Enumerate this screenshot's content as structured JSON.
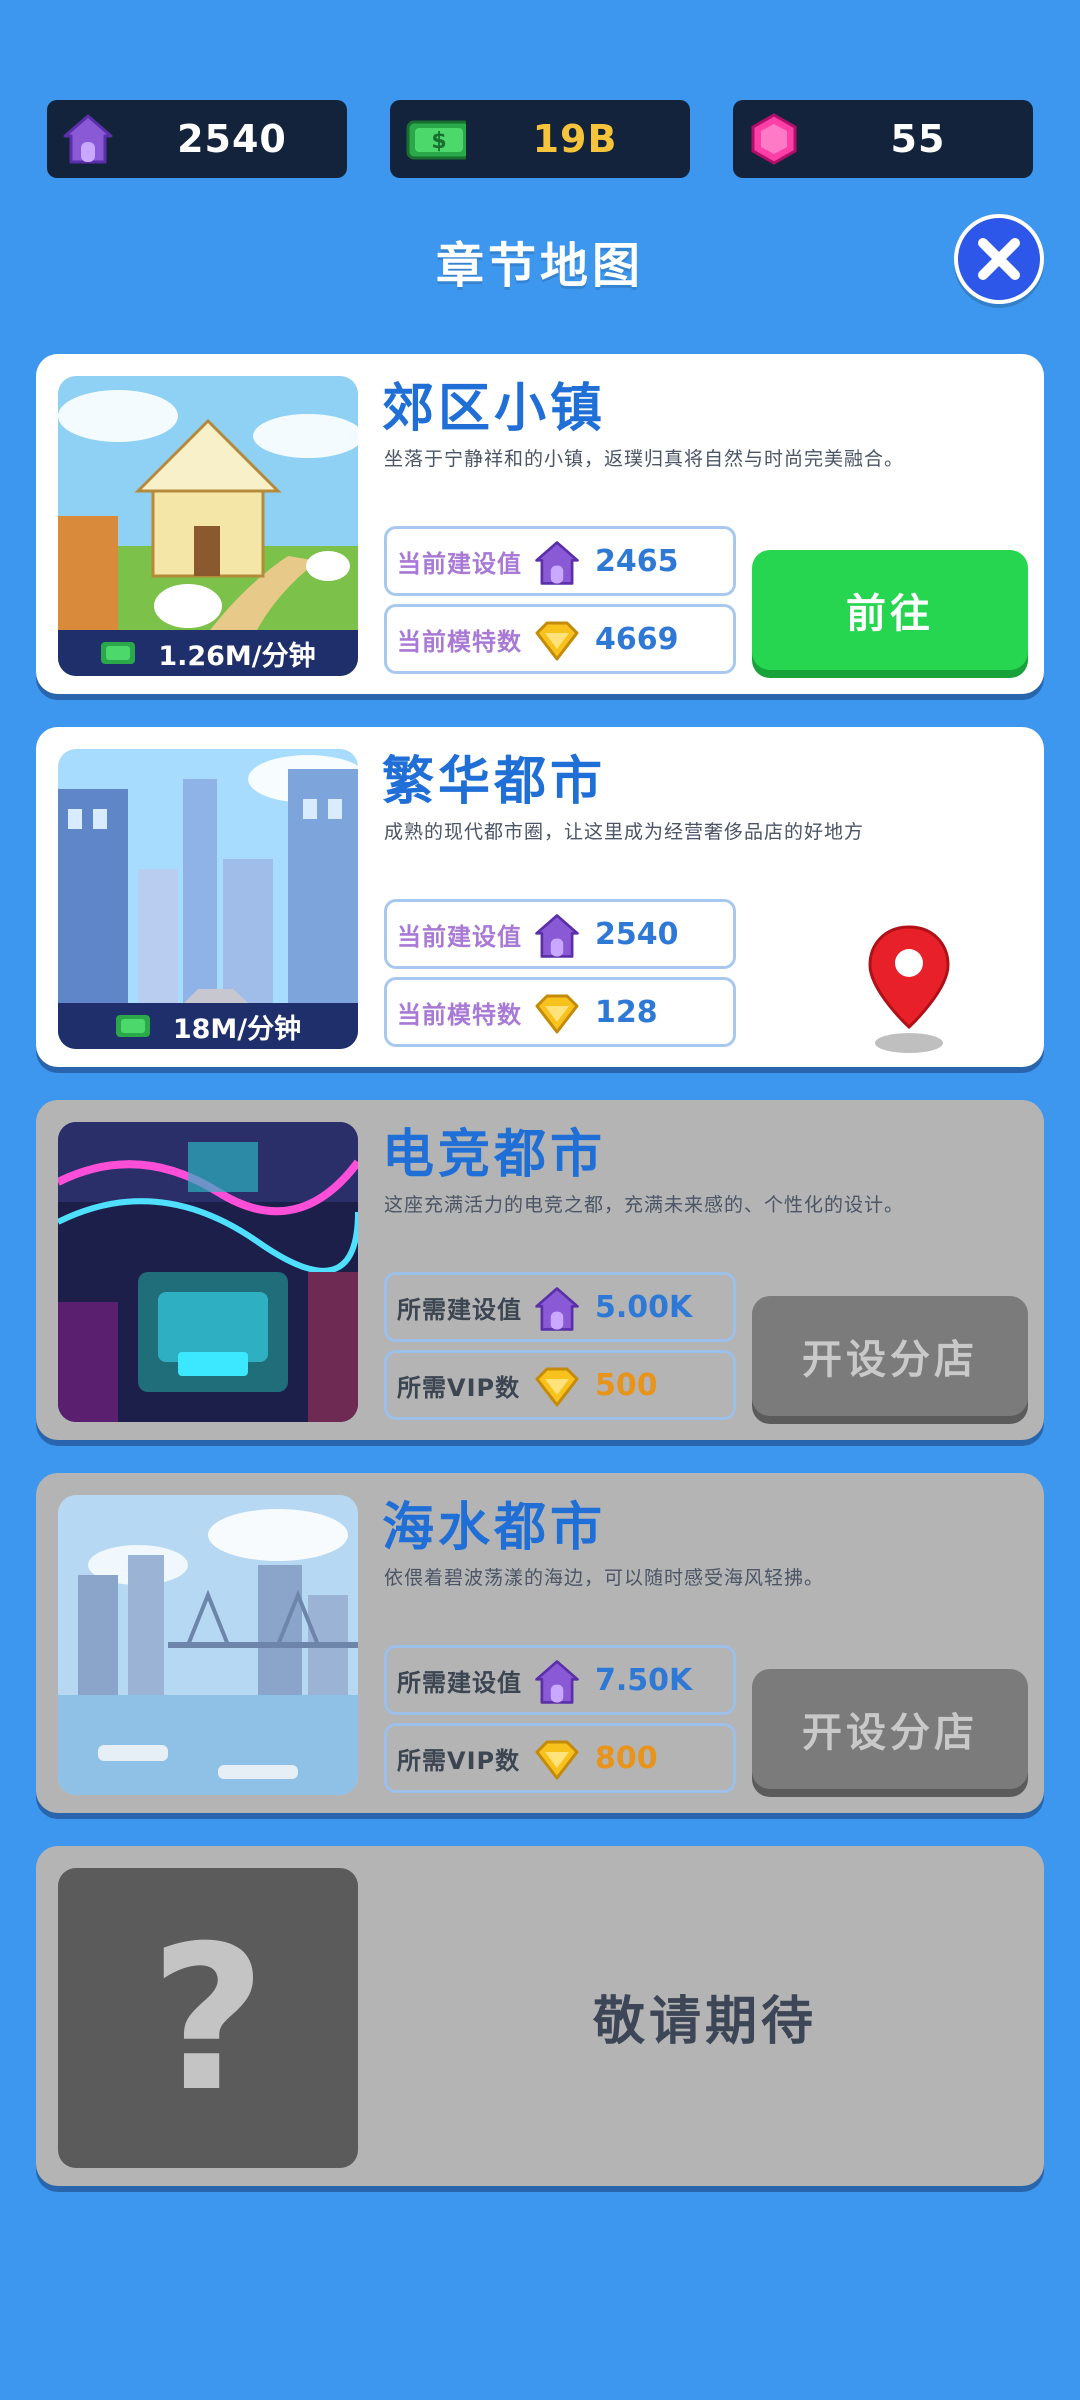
{
  "resources": {
    "build_value": "2540",
    "cash": "19B",
    "gems": "55"
  },
  "title": "章节地图",
  "colors": {
    "background": "#3d97ee",
    "card_white": "#ffffff",
    "card_locked": "#b4b4b4",
    "go_button": "#27d650",
    "locked_button": "#7b7b7b",
    "title_blue": "#1f6fd6"
  },
  "chapters": [
    {
      "name": "郊区小镇",
      "description": "坐落于宁静祥和的小镇，返璞归真将自然与时尚完美融合。",
      "rate": "1.26M/分钟",
      "stat1_label": "当前建设值",
      "stat1_value": "2465",
      "stat2_label": "当前模特数",
      "stat2_value": "4669",
      "action": "前往",
      "state": "unlocked"
    },
    {
      "name": "繁华都市",
      "description": "成熟的现代都市圈，让这里成为经营奢侈品店的好地方",
      "rate": "18M/分钟",
      "stat1_label": "当前建设值",
      "stat1_value": "2540",
      "stat2_label": "当前模特数",
      "stat2_value": "128",
      "state": "current",
      "marker_icon": "location-pin-icon"
    },
    {
      "name": "电竞都市",
      "description": "这座充满活力的电竞之都，充满未来感的、个性化的设计。",
      "stat1_label": "所需建设值",
      "stat1_value": "5.00K",
      "stat2_label": "所需VIP数",
      "stat2_value": "500",
      "action": "开设分店",
      "state": "locked"
    },
    {
      "name": "海水都市",
      "description": "依偎着碧波荡漾的海边，可以随时感受海风轻拂。",
      "stat1_label": "所需建设值",
      "stat1_value": "7.50K",
      "stat2_label": "所需VIP数",
      "stat2_value": "800",
      "action": "开设分店",
      "state": "locked"
    }
  ],
  "coming_soon": {
    "symbol": "?",
    "text": "敬请期待"
  }
}
